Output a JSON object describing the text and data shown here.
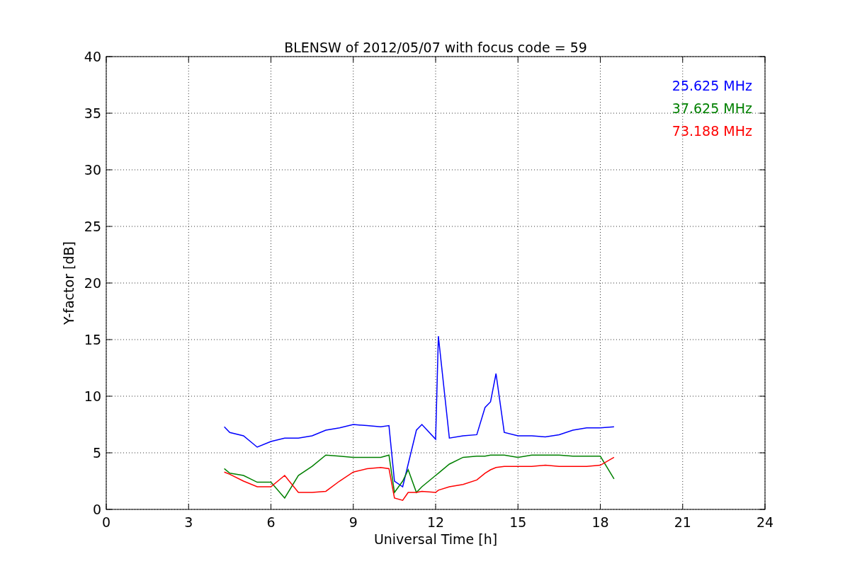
{
  "chart_data": {
    "type": "line",
    "title": "BLENSW of 2012/05/07 with focus code = 59",
    "xlabel": "Universal Time [h]",
    "ylabel": "Y-factor [dB]",
    "x": [
      4.3,
      4.5,
      5,
      5.5,
      6,
      6.5,
      7,
      7.5,
      8,
      8.5,
      9,
      9.5,
      10,
      10.3,
      10.5,
      10.8,
      11,
      11.3,
      11.5,
      12,
      12.1,
      12.5,
      13,
      13.5,
      13.8,
      14,
      14.2,
      14.5,
      15,
      15.5,
      16,
      16.5,
      17,
      17.5,
      18,
      18.5
    ],
    "series": [
      {
        "name": "25.625 MHz",
        "color": "#0000ff",
        "values": [
          7.3,
          6.8,
          6.5,
          5.5,
          6.0,
          6.3,
          6.3,
          6.5,
          7.0,
          7.2,
          7.5,
          7.4,
          7.3,
          7.4,
          2.5,
          2.0,
          4.0,
          7.0,
          7.5,
          6.2,
          15.3,
          6.3,
          6.5,
          6.6,
          9.0,
          9.5,
          12.0,
          6.8,
          6.5,
          6.5,
          6.4,
          6.6,
          7.0,
          7.2,
          7.2,
          7.3
        ]
      },
      {
        "name": "37.625 MHz",
        "color": "#008000",
        "values": [
          3.6,
          3.2,
          3.0,
          2.4,
          2.4,
          1.0,
          3.0,
          3.8,
          4.8,
          4.7,
          4.6,
          4.6,
          4.6,
          4.8,
          1.5,
          2.5,
          3.5,
          1.5,
          2.0,
          3.0,
          3.2,
          4.0,
          4.6,
          4.7,
          4.7,
          4.8,
          4.8,
          4.8,
          4.6,
          4.8,
          4.8,
          4.8,
          4.7,
          4.7,
          4.7,
          2.7
        ]
      },
      {
        "name": "73.188 MHz",
        "color": "#ff0000",
        "values": [
          3.3,
          3.1,
          2.5,
          2.0,
          2.0,
          3.0,
          1.5,
          1.5,
          1.6,
          2.5,
          3.3,
          3.6,
          3.7,
          3.6,
          1.0,
          0.8,
          1.5,
          1.5,
          1.6,
          1.5,
          1.7,
          2.0,
          2.2,
          2.6,
          3.2,
          3.5,
          3.7,
          3.8,
          3.8,
          3.8,
          3.9,
          3.8,
          3.8,
          3.8,
          3.9,
          4.6
        ]
      }
    ],
    "xlim": [
      0,
      24
    ],
    "ylim": [
      0,
      40
    ],
    "xticks": [
      0,
      3,
      6,
      9,
      12,
      15,
      18,
      21,
      24
    ],
    "yticks": [
      0,
      5,
      10,
      15,
      20,
      25,
      30,
      35,
      40
    ],
    "grid": true
  }
}
